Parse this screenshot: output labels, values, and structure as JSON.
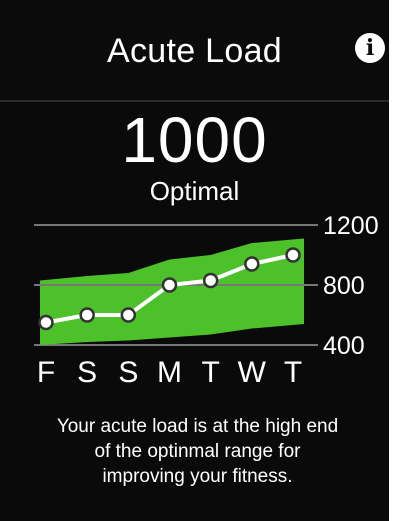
{
  "header": {
    "title": "Acute Load",
    "info_icon": "info-icon"
  },
  "reading": {
    "value": "1000",
    "status": "Optimal"
  },
  "chart_data": {
    "type": "line",
    "categories": [
      "F",
      "S",
      "S",
      "M",
      "T",
      "W",
      "T"
    ],
    "values": [
      550,
      600,
      600,
      800,
      830,
      940,
      1000
    ],
    "range_low": [
      380,
      420,
      430,
      450,
      470,
      510,
      540
    ],
    "range_high": [
      830,
      860,
      880,
      970,
      1000,
      1080,
      1110
    ],
    "y_ticks": [
      "1200",
      "800",
      "400"
    ],
    "ylim": [
      400,
      1200
    ],
    "colors": {
      "band": "#4dc12a",
      "line": "#ffffff",
      "point_fill": "#ffffff",
      "grid": "#777777"
    }
  },
  "description": {
    "lines": [
      "Your acute load is at the high end",
      "of the optinmal range for",
      "improving your fitness."
    ]
  }
}
